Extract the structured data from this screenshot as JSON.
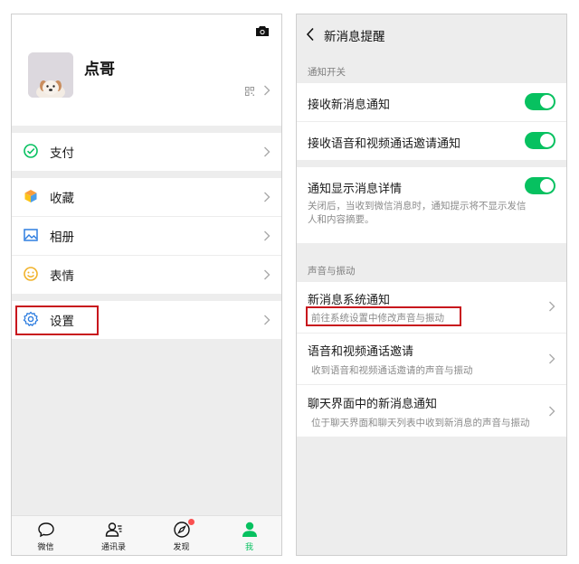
{
  "left": {
    "profile": {
      "name": "点哥"
    },
    "menu": {
      "pay": "支付",
      "favorites": "收藏",
      "album": "相册",
      "stickers": "表情",
      "settings": "设置"
    },
    "tabs": [
      "微信",
      "通讯录",
      "发现",
      "我"
    ],
    "active_tab": "我"
  },
  "right": {
    "title": "新消息提醒",
    "section_notify": "通知开关",
    "receive_new": "接收新消息通知",
    "receive_call": "接收语音和视频通话邀请通知",
    "show_detail": "通知显示消息详情",
    "show_detail_desc": "关闭后，当收到微信消息时，通知提示将不显示发信人和内容摘要。",
    "section_sound": "声音与振动",
    "sys_notify": "新消息系统通知",
    "sys_notify_desc": "前往系统设置中修改声音与振动",
    "call_invite": "语音和视频通话邀请",
    "call_invite_desc": "收到语音和视频通话邀请的声音与振动",
    "chat_notify": "聊天界面中的新消息通知",
    "chat_notify_desc": "位于聊天界面和聊天列表中收到新消息的声音与振动"
  },
  "colors": {
    "accent_green": "#07c160",
    "highlight_red": "#c8161d",
    "badge_red": "#fa5151"
  }
}
